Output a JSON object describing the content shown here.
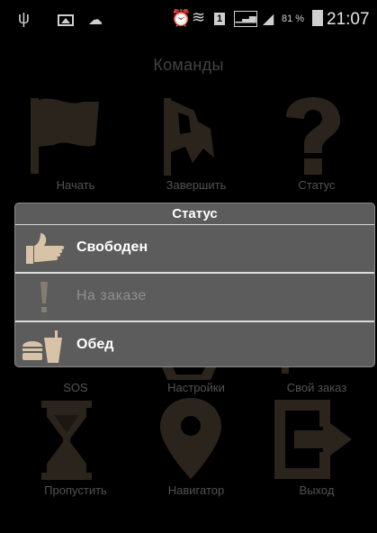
{
  "status_bar": {
    "battery_percent": "81 %",
    "time": "21:07",
    "sim_slot": "1"
  },
  "page": {
    "title": "Команды"
  },
  "grid": [
    {
      "label": "Начать",
      "icon": "flag-icon"
    },
    {
      "label": "Завершить",
      "icon": "finish-flag-icon"
    },
    {
      "label": "Статус",
      "icon": "question-icon"
    },
    {
      "label": "SOS",
      "icon": "sos-icon"
    },
    {
      "label": "Настройки",
      "icon": "gear-icon"
    },
    {
      "label": "Свой заказ",
      "icon": "own-order-icon"
    },
    {
      "label": "Пропустить",
      "icon": "hourglass-icon"
    },
    {
      "label": "Навигатор",
      "icon": "map-pin-icon"
    },
    {
      "label": "Выход",
      "icon": "exit-icon"
    }
  ],
  "dialog": {
    "title": "Статус",
    "options": [
      {
        "label": "Свободен",
        "icon": "thumbs-up-icon",
        "enabled": true
      },
      {
        "label": "На заказе",
        "icon": "exclamation-icon",
        "enabled": false
      },
      {
        "label": "Обед",
        "icon": "lunch-icon",
        "enabled": true
      }
    ]
  },
  "colors": {
    "background": "#000000",
    "icon_tan": "#3a3126",
    "dialog_bg": "#5c5c5c",
    "thumb_beige": "#d9c3a6"
  }
}
